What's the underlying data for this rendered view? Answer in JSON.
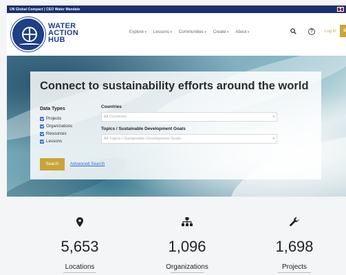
{
  "topbar": {
    "crumbs": "UN Global Compact | CEO Water Mandate"
  },
  "header": {
    "logo_lines": [
      "WATER",
      "ACTION",
      "HUB"
    ],
    "nav": [
      "Explore",
      "Lessons",
      "Communities",
      "Create",
      "About"
    ],
    "help_glyph": "?",
    "login_label": "Log In",
    "signup_label": "Si"
  },
  "hero": {
    "title": "Connect to sustainability efforts around the world",
    "data_types_label": "Data Types",
    "data_types": [
      "Projects",
      "Organizations",
      "Resources",
      "Lessons"
    ],
    "countries_label": "Countries",
    "countries_placeholder": "All Countries",
    "topics_label": "Topics / Sustainable Development Goals",
    "topics_placeholder": "All Topics / Sustainable Development Goals",
    "search_label": "Search",
    "advanced_label": "Advanced Search"
  },
  "stats": [
    {
      "icon": "location-pin-icon",
      "value": "5,653",
      "label": "Locations"
    },
    {
      "icon": "org-chart-icon",
      "value": "1,096",
      "label": "Organizations"
    },
    {
      "icon": "wrench-icon",
      "value": "1,698",
      "label": "Projects"
    }
  ],
  "colors": {
    "navy": "#1a2f6e",
    "gold": "#c9a43a",
    "link": "#2f6fd6"
  }
}
